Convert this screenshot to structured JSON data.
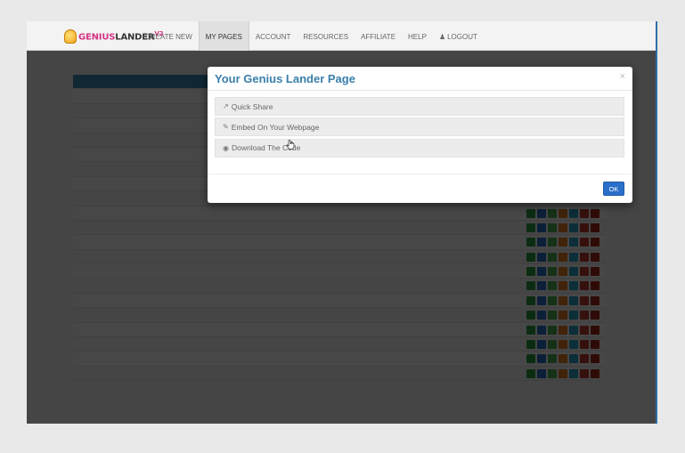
{
  "logo": {
    "part1": "GENIUS",
    "part2": "LANDER",
    "version": "V2"
  },
  "nav": [
    {
      "label": "CREATE NEW"
    },
    {
      "label": "MY PAGES",
      "active": true
    },
    {
      "label": "ACCOUNT"
    },
    {
      "label": "RESOURCES"
    },
    {
      "label": "AFFILIATE"
    },
    {
      "label": "HELP"
    },
    {
      "label": "LOGOUT",
      "icon": "user-icon"
    }
  ],
  "modal": {
    "title": "Your Genius Lander Page",
    "close": "×",
    "options": [
      {
        "label": "Quick Share",
        "icon": "share-icon"
      },
      {
        "label": "Embed On Your Webpage",
        "icon": "edit-icon"
      },
      {
        "label": "Download The Code",
        "icon": "download-icon"
      }
    ],
    "ok": "OK"
  }
}
